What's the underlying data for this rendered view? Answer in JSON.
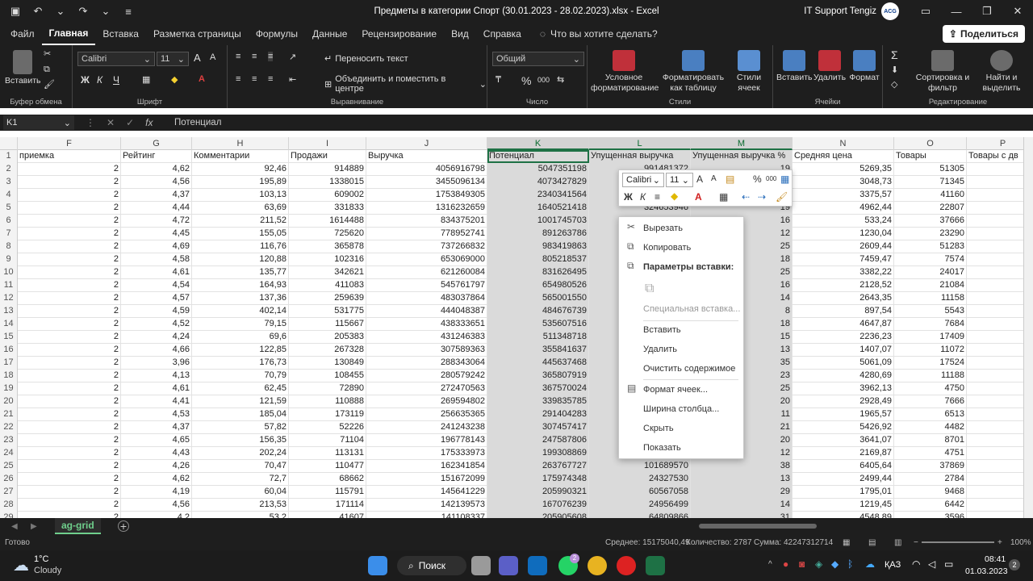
{
  "titlebar": {
    "title": "Предметы в категории Спорт (30.01.2023 - 28.02.2023).xlsx  -  Excel",
    "user": "IT Support Tengiz",
    "avatar_text": "ACG"
  },
  "menu": {
    "tabs": [
      "Файл",
      "Главная",
      "Вставка",
      "Разметка страницы",
      "Формулы",
      "Данные",
      "Рецензирование",
      "Вид",
      "Справка"
    ],
    "search_placeholder": "Что вы хотите сделать?",
    "share": "Поделиться"
  },
  "ribbon": {
    "clipboard": {
      "paste": "Вставить",
      "label": "Буфер обмена"
    },
    "font": {
      "name": "Calibri",
      "size": "11",
      "label": "Шрифт",
      "bold": "Ж",
      "italic": "К",
      "underline": "Ч",
      "grow": "A",
      "shrink": "A"
    },
    "align": {
      "wrap": "Переносить текст",
      "merge": "Объединить и поместить в центре",
      "label": "Выравнивание"
    },
    "number": {
      "format": "Общий",
      "label": "Число",
      "percent": "%",
      "thousands": "000"
    },
    "styles": {
      "cond": "Условное форматирование",
      "table": "Форматировать как таблицу",
      "cell": "Стили ячеек",
      "label": "Стили"
    },
    "cells": {
      "insert": "Вставить",
      "delete": "Удалить",
      "format": "Формат",
      "label": "Ячейки"
    },
    "editing": {
      "sort": "Сортировка и фильтр",
      "find": "Найти и выделить",
      "label": "Редактирование",
      "sigma": "Σ"
    }
  },
  "formula": {
    "namebox": "K1",
    "fx": "fx",
    "value": "Потенциал"
  },
  "columns": [
    {
      "letter": "F",
      "header": "приемка"
    },
    {
      "letter": "G",
      "header": "Рейтинг"
    },
    {
      "letter": "H",
      "header": "Комментарии"
    },
    {
      "letter": "I",
      "header": "Продажи"
    },
    {
      "letter": "J",
      "header": "Выручка"
    },
    {
      "letter": "K",
      "header": "Потенциал"
    },
    {
      "letter": "L",
      "header": "Упущенная выручка"
    },
    {
      "letter": "M",
      "header": "Упущенная выручка %"
    },
    {
      "letter": "N",
      "header": "Средняя цена"
    },
    {
      "letter": "O",
      "header": "Товары"
    },
    {
      "letter": "P",
      "header": "Товары с дв"
    }
  ],
  "rows": [
    {
      "n": "2",
      "c": [
        "2",
        "4,62",
        "92,46",
        "914889",
        "4056916798",
        "5047351198",
        "991481372",
        "19",
        "5269,35",
        "51305"
      ]
    },
    {
      "n": "3",
      "c": [
        "2",
        "4,56",
        "195,89",
        "1338015",
        "3455096134",
        "4073427829",
        "",
        "",
        "3048,73",
        "71345"
      ]
    },
    {
      "n": "4",
      "c": [
        "2",
        "4,37",
        "103,13",
        "609002",
        "1753849305",
        "2340341564",
        "",
        "",
        "3375,57",
        "41160"
      ]
    },
    {
      "n": "5",
      "c": [
        "2",
        "4,44",
        "63,69",
        "331833",
        "1316232659",
        "1640521418",
        "324653946",
        "19",
        "4962,44",
        "22807"
      ]
    },
    {
      "n": "6",
      "c": [
        "2",
        "4,72",
        "211,52",
        "1614488",
        "834375201",
        "1001745703",
        "",
        "16",
        "533,24",
        "37666"
      ]
    },
    {
      "n": "7",
      "c": [
        "2",
        "4,45",
        "155,05",
        "725620",
        "778952741",
        "891263786",
        "",
        "12",
        "1230,04",
        "23290"
      ]
    },
    {
      "n": "8",
      "c": [
        "2",
        "4,69",
        "116,76",
        "365878",
        "737266832",
        "983419863",
        "",
        "25",
        "2609,44",
        "51283"
      ]
    },
    {
      "n": "9",
      "c": [
        "2",
        "4,58",
        "120,88",
        "102316",
        "653069000",
        "805218537",
        "",
        "18",
        "7459,47",
        "7574"
      ]
    },
    {
      "n": "10",
      "c": [
        "2",
        "4,61",
        "135,77",
        "342621",
        "621260084",
        "831626495",
        "",
        "25",
        "3382,22",
        "24017"
      ]
    },
    {
      "n": "11",
      "c": [
        "2",
        "4,54",
        "164,93",
        "411083",
        "545761797",
        "654980526",
        "",
        "16",
        "2128,52",
        "21084"
      ]
    },
    {
      "n": "12",
      "c": [
        "2",
        "4,57",
        "137,36",
        "259639",
        "483037864",
        "565001550",
        "",
        "14",
        "2643,35",
        "11158"
      ]
    },
    {
      "n": "13",
      "c": [
        "2",
        "4,59",
        "402,14",
        "531775",
        "444048387",
        "484676739",
        "",
        "8",
        "897,54",
        "5543"
      ]
    },
    {
      "n": "14",
      "c": [
        "2",
        "4,52",
        "79,15",
        "115667",
        "438333651",
        "535607516",
        "",
        "18",
        "4647,87",
        "7684"
      ]
    },
    {
      "n": "15",
      "c": [
        "2",
        "4,24",
        "69,6",
        "205383",
        "431246383",
        "511348718",
        "",
        "15",
        "2236,23",
        "17409"
      ]
    },
    {
      "n": "16",
      "c": [
        "2",
        "4,66",
        "122,85",
        "267328",
        "307589363",
        "355841637",
        "",
        "13",
        "1407,07",
        "11072"
      ]
    },
    {
      "n": "17",
      "c": [
        "2",
        "3,96",
        "176,73",
        "130849",
        "288343064",
        "445637468",
        "",
        "35",
        "5061,09",
        "17524"
      ]
    },
    {
      "n": "18",
      "c": [
        "2",
        "4,13",
        "70,79",
        "108455",
        "280579242",
        "365807919",
        "",
        "23",
        "4280,69",
        "11188"
      ]
    },
    {
      "n": "19",
      "c": [
        "2",
        "4,61",
        "62,45",
        "72890",
        "272470563",
        "367570024",
        "",
        "25",
        "3962,13",
        "4750"
      ]
    },
    {
      "n": "20",
      "c": [
        "2",
        "4,41",
        "121,59",
        "110888",
        "269594802",
        "339835785",
        "",
        "20",
        "2928,49",
        "7666"
      ]
    },
    {
      "n": "21",
      "c": [
        "2",
        "4,53",
        "185,04",
        "173119",
        "256635365",
        "291404283",
        "",
        "11",
        "1965,57",
        "6513"
      ]
    },
    {
      "n": "22",
      "c": [
        "2",
        "4,37",
        "57,82",
        "52226",
        "241243238",
        "307457417",
        "",
        "21",
        "5426,92",
        "4482"
      ]
    },
    {
      "n": "23",
      "c": [
        "2",
        "4,65",
        "156,35",
        "71104",
        "196778143",
        "247587806",
        "",
        "20",
        "3641,07",
        "8701"
      ]
    },
    {
      "n": "24",
      "c": [
        "2",
        "4,43",
        "202,24",
        "113131",
        "175333973",
        "199308869",
        "",
        "12",
        "2169,87",
        "4751"
      ]
    },
    {
      "n": "25",
      "c": [
        "2",
        "4,26",
        "70,47",
        "110477",
        "162341854",
        "263767727",
        "101689570",
        "38",
        "6405,64",
        "37869"
      ]
    },
    {
      "n": "26",
      "c": [
        "2",
        "4,62",
        "72,7",
        "68662",
        "151672099",
        "175974348",
        "24327530",
        "13",
        "2499,44",
        "2784"
      ]
    },
    {
      "n": "27",
      "c": [
        "2",
        "4,19",
        "60,04",
        "115791",
        "145641229",
        "205990321",
        "60567058",
        "29",
        "1795,01",
        "9468"
      ]
    },
    {
      "n": "28",
      "c": [
        "2",
        "4,56",
        "213,53",
        "171114",
        "142139573",
        "167076239",
        "24956499",
        "14",
        "1219,45",
        "6442"
      ]
    },
    {
      "n": "29",
      "c": [
        "2",
        "4,2",
        "53,2",
        "41607",
        "141108337",
        "205905608",
        "64809866",
        "31",
        "4548,89",
        "3596"
      ]
    }
  ],
  "context_menu": {
    "cut": "Вырезать",
    "copy": "Копировать",
    "paste_options": "Параметры вставки:",
    "special": "Специальная вставка...",
    "insert": "Вставить",
    "delete": "Удалить",
    "clear": "Очистить содержимое",
    "format": "Формат ячеек...",
    "width": "Ширина столбца...",
    "hide": "Скрыть",
    "show": "Показать"
  },
  "mini_toolbar": {
    "font": "Calibri",
    "size": "11",
    "bold": "Ж",
    "italic": "К"
  },
  "sheet": {
    "tab": "ag-grid"
  },
  "status": {
    "ready": "Готово",
    "avg": "Среднее: 15175040,49",
    "count": "Количество: 2787",
    "sum": "Сумма: 42247312714",
    "zoom": "100%"
  },
  "taskbar": {
    "temp": "1°C",
    "weather": "Cloudy",
    "search": "Поиск",
    "lang": "ҚАЗ",
    "time": "08:41",
    "date": "01.03.2023",
    "badge": "2",
    "notif": "2"
  }
}
